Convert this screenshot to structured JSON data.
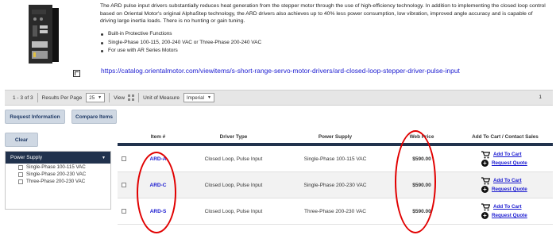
{
  "product": {
    "description": "The ARD pulse input drivers substantially reduces heat generation from the stepper motor through the use of high-efficiency technology. In addition to implementing the closed loop control based on Oriental Motor's original AlphaStep technology, the ARD drivers also achieves up to 40% less power consumption, low vibration, improved angle accuracy and is capable of driving large inertia loads. There is no hunting or gain tuning.",
    "bullets": [
      "Built-in Protective Functions",
      "Single-Phase 100-115, 200-240 VAC or Three-Phase 200-240 VAC",
      "For use with AR Series Motors"
    ],
    "url": "https://catalog.orientalmotor.com/viewitems/s-short-range-servo-motor-drivers/ard-closed-loop-stepper-driver-pulse-input"
  },
  "pagination": {
    "range": "1 - 3 of 3",
    "results_per_page_label": "Results Per Page",
    "results_per_page_value": "25",
    "view_label": "View",
    "uom_label": "Unit of Measure",
    "uom_value": "Imperial",
    "page": "1"
  },
  "buttons": {
    "request_info": "Request Information",
    "compare": "Compare Items",
    "clear": "Clear"
  },
  "filter": {
    "title": "Power Supply",
    "options": [
      "Single-Phase 100-115 VAC",
      "Single-Phase 200-230 VAC",
      "Three-Phase 200-230 VAC"
    ]
  },
  "table": {
    "headers": [
      "Item #",
      "Driver Type",
      "Power Supply",
      "Web Price",
      "Add To Cart / Contact Sales"
    ],
    "rows": [
      {
        "item": "ARD-A",
        "driver_type": "Closed Loop, Pulse Input",
        "power_supply": "Single-Phase 100-115 VAC",
        "price": "$590.00",
        "add_to_cart": "Add To Cart",
        "request_quote": "Request Quote"
      },
      {
        "item": "ARD-C",
        "driver_type": "Closed Loop, Pulse Input",
        "power_supply": "Single-Phase 200-230 VAC",
        "price": "$590.00",
        "add_to_cart": "Add To Cart",
        "request_quote": "Request Quote"
      },
      {
        "item": "ARD-S",
        "driver_type": "Closed Loop, Pulse Input",
        "power_supply": "Three-Phase 200-230 VAC",
        "price": "$590.00",
        "add_to_cart": "Add To Cart",
        "request_quote": "Request Quote"
      }
    ]
  },
  "colors": {
    "header_navy": "#21324d",
    "link_blue": "#1a1ad0",
    "annotation_red": "#e10000",
    "button_bg": "#cfd8e3"
  }
}
